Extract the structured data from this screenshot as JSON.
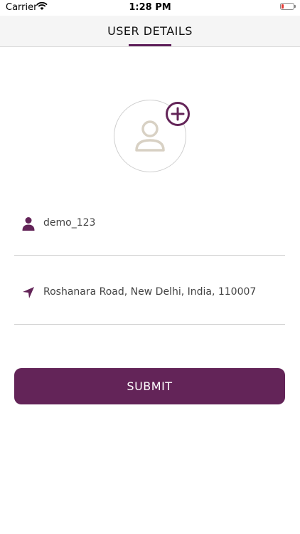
{
  "status_bar": {
    "carrier": "Carrier",
    "time": "1:28 PM"
  },
  "header": {
    "title": "USER DETAILS"
  },
  "profile": {
    "avatar_icon": "user-outline-icon",
    "add_icon": "plus-circle-icon"
  },
  "form": {
    "username_value": "demo_123",
    "address_value": "Roshanara Road, New Delhi, India, 110007"
  },
  "actions": {
    "submit_label": "SUBMIT"
  },
  "colors": {
    "accent": "#632458",
    "divider": "#cfcfcf",
    "avatar_placeholder": "#d8d1c4"
  }
}
